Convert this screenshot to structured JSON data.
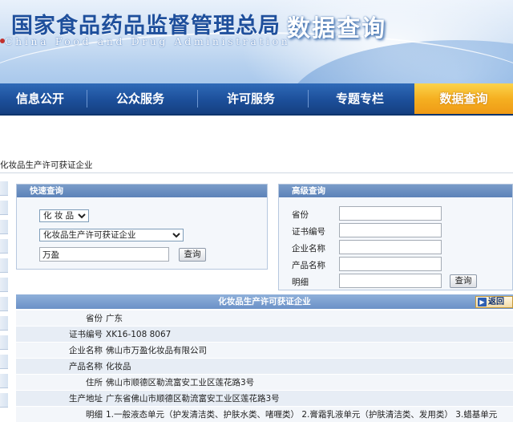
{
  "header": {
    "title_cn": "国家食品药品监督管理总局",
    "title_en": "China Food and Drug Administration",
    "section_title": "数据查询"
  },
  "nav": {
    "items": [
      "信息公开",
      "公众服务",
      "许可服务",
      "专题专栏",
      "数据查询"
    ],
    "active": "数据查询"
  },
  "breadcrumb": "化妆品生产许可获证企业",
  "quick_search": {
    "title": "快速查询",
    "category": "化 妆 品",
    "database": "化妆品生产许可获证企业",
    "keyword": "万盈",
    "button": "查询"
  },
  "advanced_search": {
    "title": "高级查询",
    "fields": [
      "省份",
      "证书编号",
      "企业名称",
      "产品名称",
      "明细"
    ],
    "button": "查询"
  },
  "result": {
    "title": "化妆品生产许可获证企业",
    "back_label": "返回",
    "rows": [
      {
        "key": "省份",
        "value": "广东"
      },
      {
        "key": "证书编号",
        "value": "XK16-108 8067"
      },
      {
        "key": "企业名称",
        "value": "佛山市万盈化妆品有限公司"
      },
      {
        "key": "产品名称",
        "value": "化妆品"
      },
      {
        "key": "住所",
        "value": "佛山市顺德区勒流富安工业区莲花路3号"
      },
      {
        "key": "生产地址",
        "value": "广东省佛山市顺德区勒流富安工业区莲花路3号"
      },
      {
        "key": "明细",
        "value": "1.一般液态单元（护发清洁类、护肤水类、啫喱类） 2.膏霜乳液单元（护肤清洁类、发用类） 3.蜡基单元"
      }
    ]
  },
  "colors": {
    "nav_blue": "#1c4f9a",
    "nav_active": "#f5b021",
    "panel_header": "#5c82b8"
  }
}
